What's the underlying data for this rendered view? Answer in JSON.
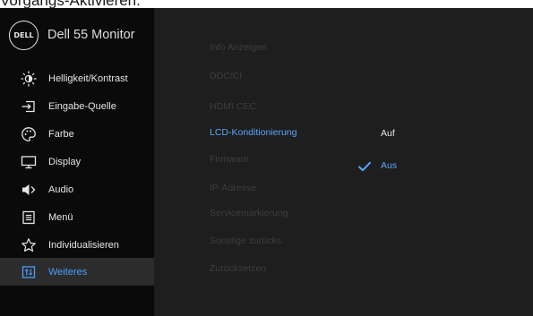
{
  "caption": "Vorgangs-Aktivieren.",
  "brand": {
    "logo_text": "DELL",
    "model": "Dell 55 Monitor"
  },
  "sidebar": {
    "items": [
      {
        "label": "Helligkeit/Kontrast",
        "icon": "brightness-icon"
      },
      {
        "label": "Eingabe-Quelle",
        "icon": "input-source-icon"
      },
      {
        "label": "Farbe",
        "icon": "color-palette-icon"
      },
      {
        "label": "Display",
        "icon": "display-monitor-icon"
      },
      {
        "label": "Audio",
        "icon": "speaker-icon"
      },
      {
        "label": "Menü",
        "icon": "menu-icon"
      },
      {
        "label": "Individualisieren",
        "icon": "star-icon"
      },
      {
        "label": "Weiteres",
        "icon": "others-icon",
        "active": true
      }
    ]
  },
  "submenu": {
    "items": [
      "Info Anzeigen",
      "DDC/CI",
      "HDMI CEC",
      "LCD-Konditionierung",
      "Firmware",
      "IP-Adresse",
      "Servicemarkierung",
      "Sonstige zurücks.",
      "Zurücksetzen"
    ],
    "selected": "LCD-Konditionierung"
  },
  "options": {
    "items": [
      "Auf",
      "Aus"
    ],
    "selected": "Aus"
  },
  "colors": {
    "accent": "#4a9eff",
    "panel": "#1e1e1e",
    "sidebar": "#0a0a0a",
    "active_row": "#2c2c2c"
  }
}
